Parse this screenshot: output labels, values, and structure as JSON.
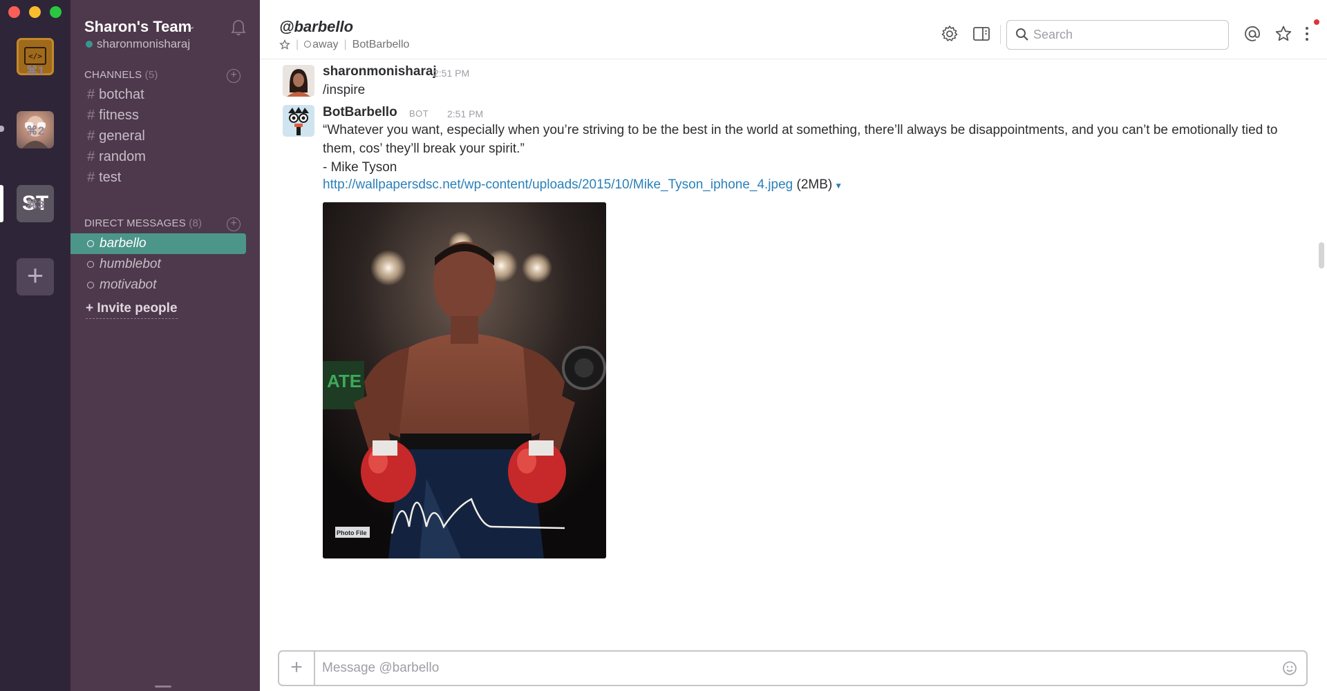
{
  "rail": {
    "teams": [
      {
        "shortcut": "⌘1"
      },
      {
        "shortcut": "⌘2"
      },
      {
        "initials": "ST",
        "shortcut": "⌘3"
      }
    ],
    "add_team_label": "+"
  },
  "sidebar": {
    "team_name": "Sharon's Team",
    "username": "sharonmonisharaj",
    "channels_title": "CHANNELS",
    "channels_count": "(5)",
    "channels": [
      "botchat",
      "fitness",
      "general",
      "random",
      "test"
    ],
    "dm_title": "DIRECT MESSAGES",
    "dm_count": "(8)",
    "direct_messages": [
      "barbello",
      "humblebot",
      "motivabot"
    ],
    "selected_dm": "barbello",
    "invite_label": "+ Invite people",
    "colors": {
      "background": "#4d394b",
      "selected": "#4c9689",
      "rail": "#2f2538"
    }
  },
  "header": {
    "title": "@barbello",
    "status": "away",
    "display_name": "BotBarbello",
    "search_placeholder": "Search"
  },
  "messages": [
    {
      "author": "sharonmonisharaj",
      "time": "2:51 PM",
      "text": "/inspire"
    },
    {
      "author": "BotBarbello",
      "badge": "BOT",
      "time": "2:51 PM",
      "text_line1": "“Whatever you want, especially when you’re striving to be the best in the world at something, there’ll always be disappointments, and you can’t be emotionally tied to",
      "text_line2": "them, cos’ they’ll break your spirit.”",
      "text_line3": "- Mike Tyson",
      "attachment_url": "http://wallpapersdsc.net/wp-content/uploads/2015/10/Mike_Tyson_iphone_4.jpeg",
      "attachment_size": "(2MB)"
    }
  ],
  "composer": {
    "placeholder": "Message @barbello",
    "add_label": "+"
  }
}
